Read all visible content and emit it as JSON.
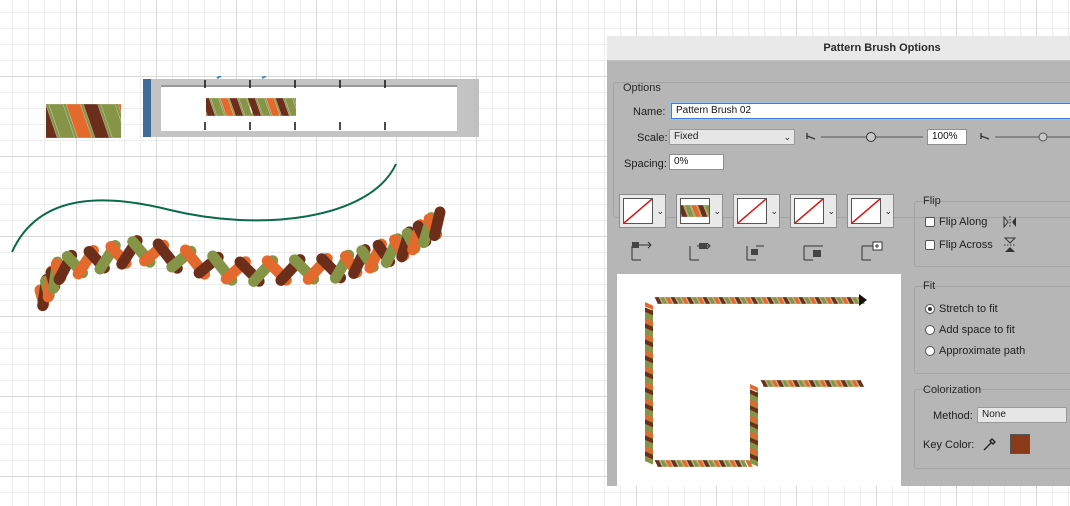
{
  "canvas": {
    "braid_colors": [
      "#e36a2c",
      "#6b2e1a",
      "#869448"
    ],
    "guide_path_color": "#0a6a4a",
    "ruler_ticks": 6
  },
  "dialog": {
    "title": "Pattern Brush Options",
    "options_legend": "Options",
    "name_label": "Name:",
    "name_value": "Pattern Brush 02",
    "scale_label": "Scale:",
    "scale_value": "Fixed",
    "scale_percent": "100%",
    "spacing_label": "Spacing:",
    "spacing_value": "0%",
    "tiles": [
      {
        "id": "side-tile",
        "pattern": "none"
      },
      {
        "id": "outer-corner-tile",
        "pattern": "braid"
      },
      {
        "id": "inner-corner-tile",
        "pattern": "none"
      },
      {
        "id": "start-tile",
        "pattern": "none"
      },
      {
        "id": "end-tile",
        "pattern": "none"
      }
    ],
    "flip": {
      "legend": "Flip",
      "along_label": "Flip Along",
      "across_label": "Flip Across",
      "along_checked": false,
      "across_checked": false
    },
    "fit": {
      "legend": "Fit",
      "options": [
        "Stretch to fit",
        "Add space to fit",
        "Approximate path"
      ],
      "selected": "Stretch to fit"
    },
    "colorization": {
      "legend": "Colorization",
      "method_label": "Method:",
      "method_value": "None",
      "key_color_label": "Key Color:",
      "key_color": "#8a3a18"
    }
  }
}
